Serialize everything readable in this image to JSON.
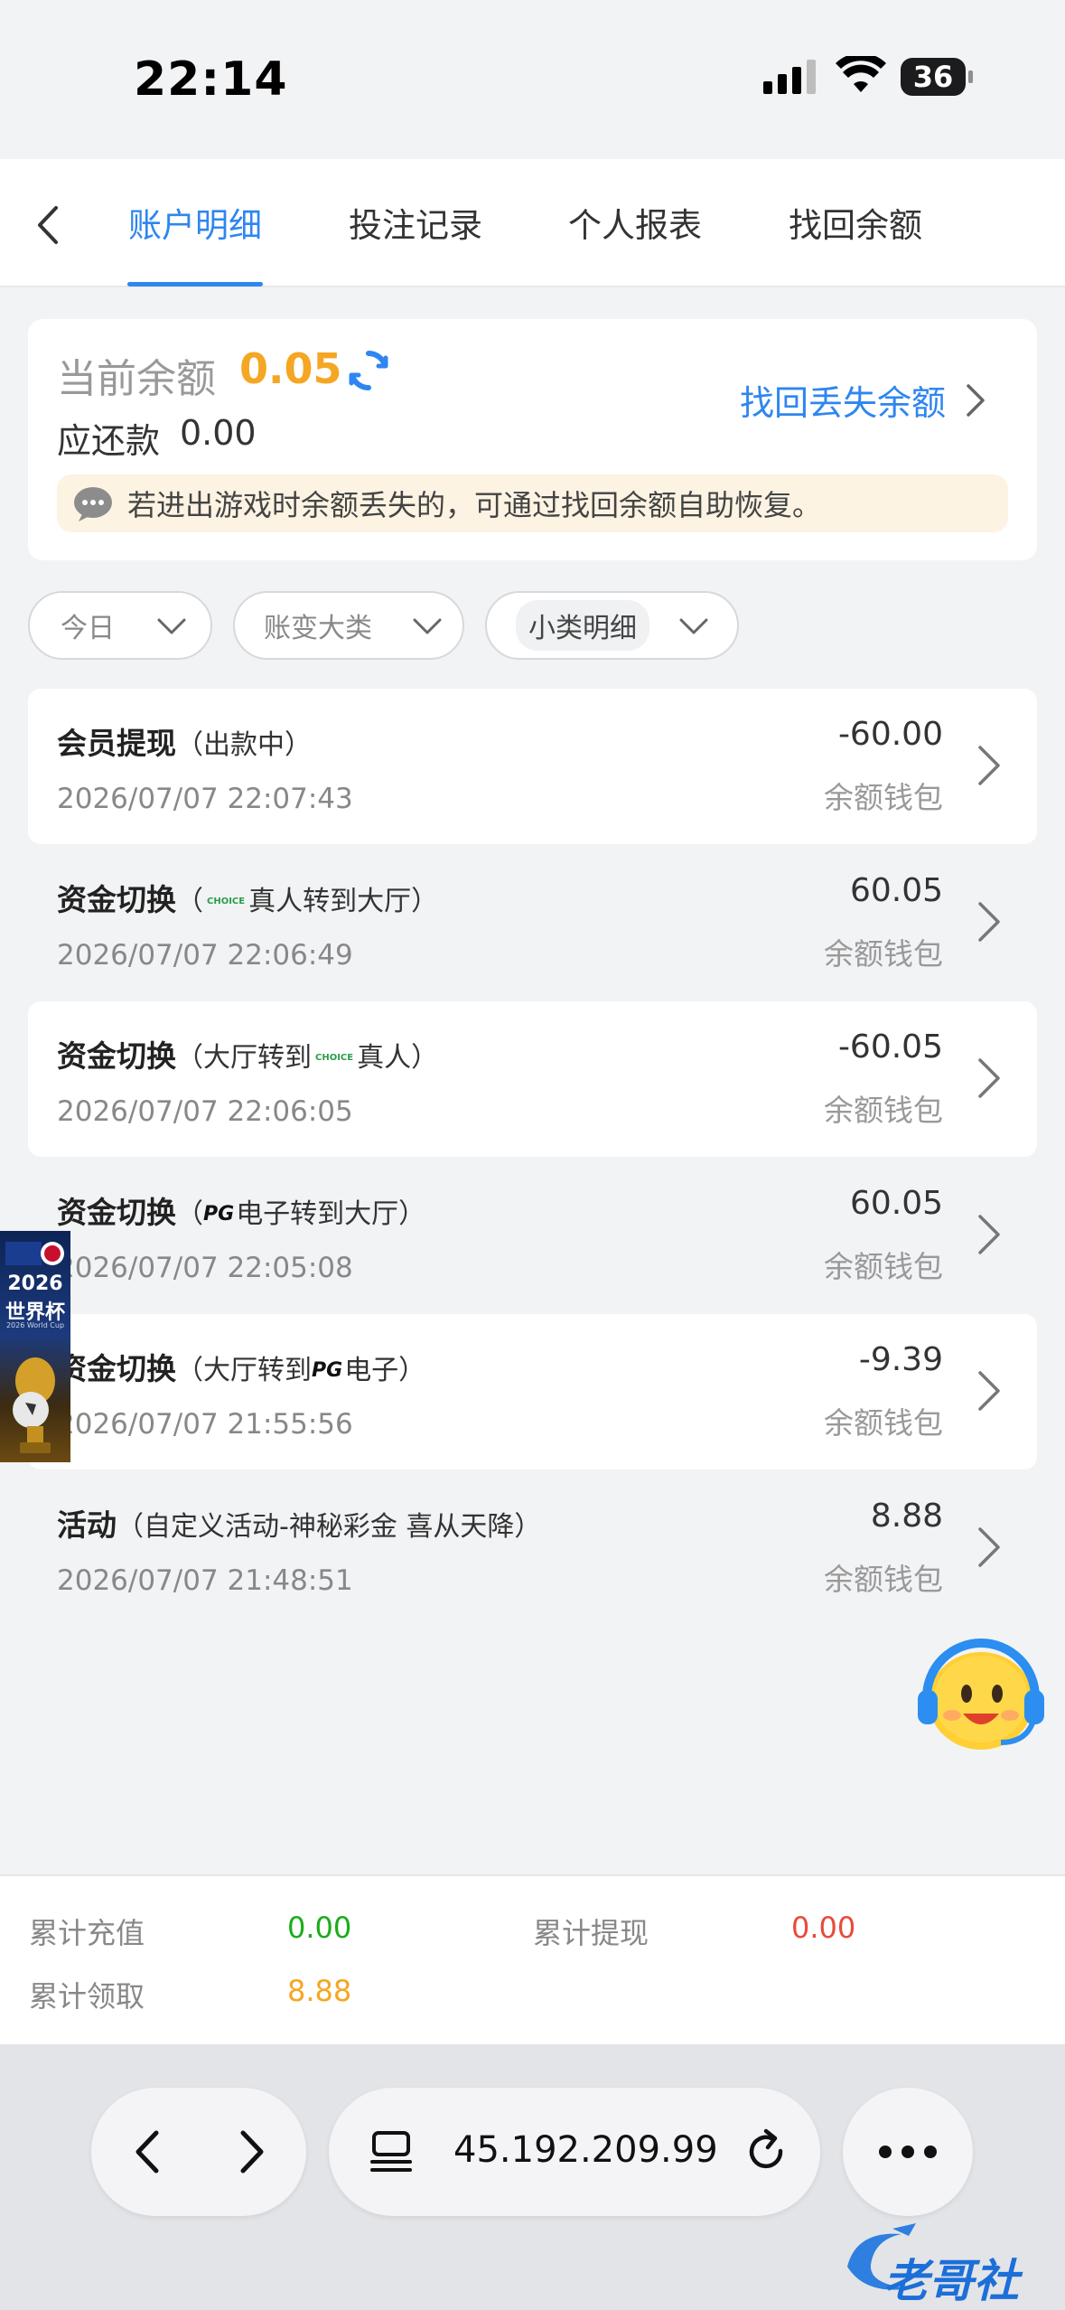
{
  "status_bar": {
    "time": "22:14",
    "battery": "36"
  },
  "nav": {
    "tabs": [
      {
        "label": "账户明细",
        "active": true
      },
      {
        "label": "投注记录",
        "active": false
      },
      {
        "label": "个人报表",
        "active": false
      },
      {
        "label": "找回余额",
        "active": false
      }
    ]
  },
  "balance": {
    "label": "当前余额",
    "value": "0.05",
    "owe_label": "应还款",
    "owe_value": "0.00",
    "recover_link": "找回丢失余额",
    "notice": "若进出游戏时余额丢失的，可通过找回余额自助恢复。"
  },
  "filters": [
    {
      "label": "今日"
    },
    {
      "label": "账变大类"
    },
    {
      "label": "小类明细"
    }
  ],
  "transactions": [
    {
      "type": "会员提现",
      "detail_pre": "（出款中）",
      "logo": "",
      "detail_post": "",
      "time": "2026/07/07 22:07:43",
      "amount": "-60.00",
      "wallet": "余额钱包"
    },
    {
      "type": "资金切换",
      "detail_pre": "（",
      "logo": "CHOICE",
      "detail_post": "真人转到大厅）",
      "time": "2026/07/07 22:06:49",
      "amount": "60.05",
      "wallet": "余额钱包"
    },
    {
      "type": "资金切换",
      "detail_pre": "（大厅转到",
      "logo": "CHOICE",
      "detail_post": "真人）",
      "time": "2026/07/07 22:06:05",
      "amount": "-60.05",
      "wallet": "余额钱包"
    },
    {
      "type": "资金切换",
      "detail_pre": "（",
      "logo": "PG",
      "detail_post": "电子转到大厅）",
      "time": "2026/07/07 22:05:08",
      "amount": "60.05",
      "wallet": "余额钱包"
    },
    {
      "type": "资金切换",
      "detail_pre": "（大厅转到",
      "logo": "PG",
      "detail_post": "电子）",
      "time": "2026/07/07 21:55:56",
      "amount": "-9.39",
      "wallet": "余额钱包"
    },
    {
      "type": "活动",
      "detail_pre": "（自定义活动-神秘彩金 喜从天降）",
      "logo": "",
      "detail_post": "",
      "time": "2026/07/07 21:48:51",
      "amount": "8.88",
      "wallet": "余额钱包"
    }
  ],
  "world_cup": {
    "year": "2026",
    "name": "世界杯",
    "sub": "2026 World Cup"
  },
  "summary": {
    "recharge_label": "累计充值",
    "recharge_value": "0.00",
    "withdraw_label": "累计提现",
    "withdraw_value": "0.00",
    "claim_label": "累计领取",
    "claim_value": "8.88"
  },
  "browser": {
    "url": "45.192.209.99"
  },
  "watermark": "老哥社区",
  "colors": {
    "accent": "#2e86f0",
    "balance": "#f5a623",
    "green": "#1aad19",
    "red": "#e84a3c"
  }
}
